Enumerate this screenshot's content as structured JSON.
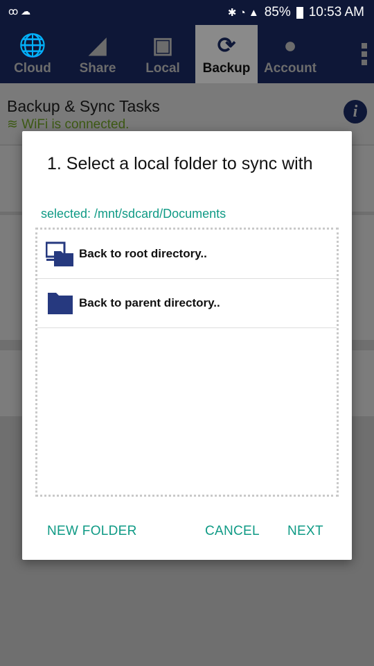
{
  "status": {
    "left_icons": [
      "voicemail-icon",
      "cloud-upload-icon"
    ],
    "battery": "85%",
    "time": "10:53 AM"
  },
  "tabs": [
    {
      "label": "Cloud",
      "icon": "globe-folder-icon"
    },
    {
      "label": "Share",
      "icon": "share-icon"
    },
    {
      "label": "Local",
      "icon": "local-folder-icon"
    },
    {
      "label": "Backup",
      "icon": "sync-icon",
      "selected": true
    },
    {
      "label": "Account",
      "icon": "person-icon"
    }
  ],
  "page": {
    "title": "Backup & Sync Tasks",
    "wifi": "WiFi is connected."
  },
  "dialog": {
    "title": "1. Select a local folder to sync with",
    "selected": "selected: /mnt/sdcard/Documents",
    "items": [
      {
        "label": "Back to root directory..",
        "icon": "computer-folder-icon"
      },
      {
        "label": "Back to parent directory..",
        "icon": "folder-icon"
      }
    ],
    "buttons": {
      "new_folder": "NEW FOLDER",
      "cancel": "CANCEL",
      "next": "NEXT"
    }
  },
  "colors": {
    "header": "#0e1737",
    "accent": "#0f9a85",
    "folder": "#26397f"
  }
}
